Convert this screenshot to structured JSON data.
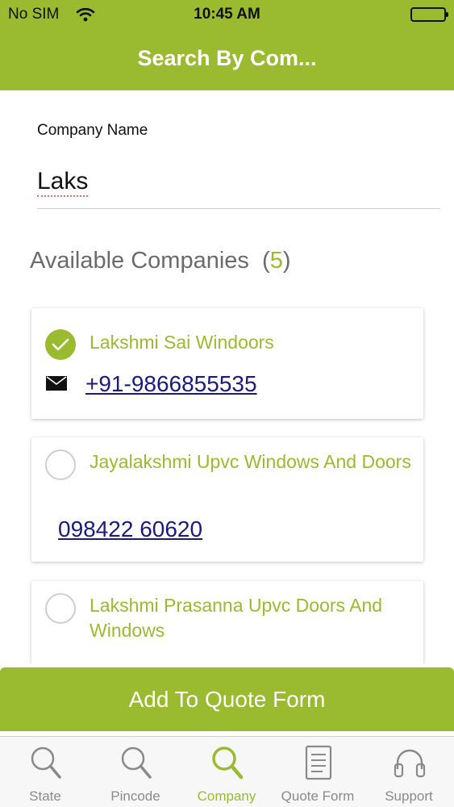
{
  "status_bar": {
    "carrier": "No SIM",
    "time": "10:45 AM"
  },
  "nav": {
    "title": "Search By Com..."
  },
  "search": {
    "label": "Company Name",
    "value": "Laks"
  },
  "section": {
    "title": "Available Companies",
    "count_open": "(",
    "count": "5",
    "count_close": ")"
  },
  "companies": [
    {
      "name": "Lakshmi Sai Windoors",
      "phone": "+91-9866855535",
      "selected": true,
      "icon": "mail-icon"
    },
    {
      "name": "Jayalakshmi Upvc Windows And Doors",
      "phone": "098422 60620",
      "selected": false
    },
    {
      "name": "Lakshmi Prasanna Upvc Doors And Windows",
      "phone": "",
      "selected": false
    }
  ],
  "add_button": {
    "label": "Add To Quote Form"
  },
  "tabs": [
    {
      "label": "State",
      "icon": "search-icon",
      "active": false
    },
    {
      "label": "Pincode",
      "icon": "search-icon",
      "active": false
    },
    {
      "label": "Company",
      "icon": "search-icon",
      "active": true
    },
    {
      "label": "Quote Form",
      "icon": "document-icon",
      "active": false
    },
    {
      "label": "Support",
      "icon": "headset-icon",
      "active": false
    }
  ],
  "colors": {
    "accent": "#9aba2f",
    "link": "#1a1a80",
    "muted": "#8a8a8a"
  }
}
